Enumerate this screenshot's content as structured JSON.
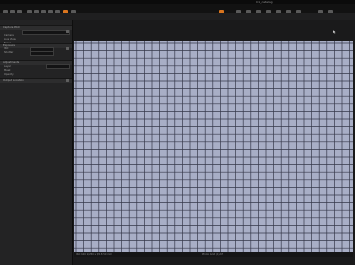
{
  "window": {
    "title": "C1_catalog"
  },
  "toolbar": {
    "accent_color": "#d9751e",
    "icons": [
      "import-icon",
      "undo-icon",
      "redo-icon",
      "sync-icon",
      "grid-icon",
      "rotate-icon",
      "crop-icon",
      "picker-icon",
      "cursor-icon",
      "pan-icon",
      "zoom-icon",
      "straighten-icon",
      "keystone-icon",
      "mask-icon",
      "brush-icon",
      "erase-icon"
    ]
  },
  "sidebar": {
    "panel1": {
      "label": "Capture Pilot",
      "row_a": "Camera",
      "row_b": "Live View",
      "row_c": "Focus",
      "field_value": "100"
    },
    "panel2": {
      "label": "Exposure",
      "row_a": "ISO",
      "row_b": "Shutter",
      "value_a": "100",
      "value_b": "100"
    },
    "panel3": {
      "label": "Adjustments",
      "row_a": "Layer",
      "row_b": "Mask",
      "row_c": "Opacity",
      "tag": "Copy"
    },
    "panel4": {
      "label": "Output Location",
      "row_a": "Recipe"
    }
  },
  "viewer": {
    "grid_color": "#36384a",
    "background_color": "#a8aec6"
  },
  "status": {
    "meta": "ISO 100   1/250 s   f/2.8   50 mm",
    "filename": "Photo Grid (1).tif"
  }
}
